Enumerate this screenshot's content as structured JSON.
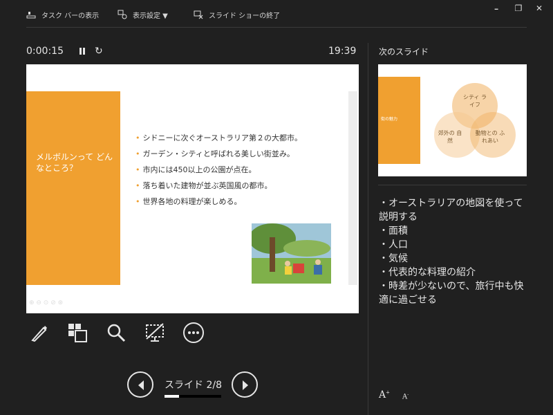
{
  "toolbar": {
    "taskbar_label": "タスク バーの表示",
    "display_settings_label": "表示設定 ▼",
    "end_show_label": "スライド ショーの終了"
  },
  "window": {
    "minimize": "━",
    "restore": "❐",
    "close": "✕"
  },
  "presenter": {
    "timer": "0:00:15",
    "clock": "19:39"
  },
  "slide": {
    "title": "メルボルンって どんなところ？",
    "bullets": [
      "シドニーに次ぐオーストラリア第２の大都市。",
      "ガーデン・シティと呼ばれる美しい街並み。",
      "市内には450以上の公園が点在。",
      "落ち着いた建物が並ぶ英国風の都市。",
      "世界各地の料理が楽しめる。"
    ],
    "bullet_marker": "•"
  },
  "navigation": {
    "slide_label": "スライド 2/8",
    "progress": 0.25
  },
  "next_slide": {
    "heading": "次のスライド",
    "orange_label": "街の魅力",
    "circles": [
      "シティ ライフ",
      "郊外の 自然",
      "動物との ふれあい"
    ]
  },
  "notes": {
    "lines": [
      "・オーストラリアの地図を使って説明する",
      "",
      "・面積",
      "・人口",
      "・気候",
      "・代表的な料理の紹介",
      "・時差が少ないので、旅行中も快適に過ごせる"
    ]
  },
  "font_buttons": {
    "larger": "A",
    "smaller": "A"
  },
  "colors": {
    "accent": "#f0a030",
    "background": "#202020",
    "text": "#e6e6e6"
  }
}
